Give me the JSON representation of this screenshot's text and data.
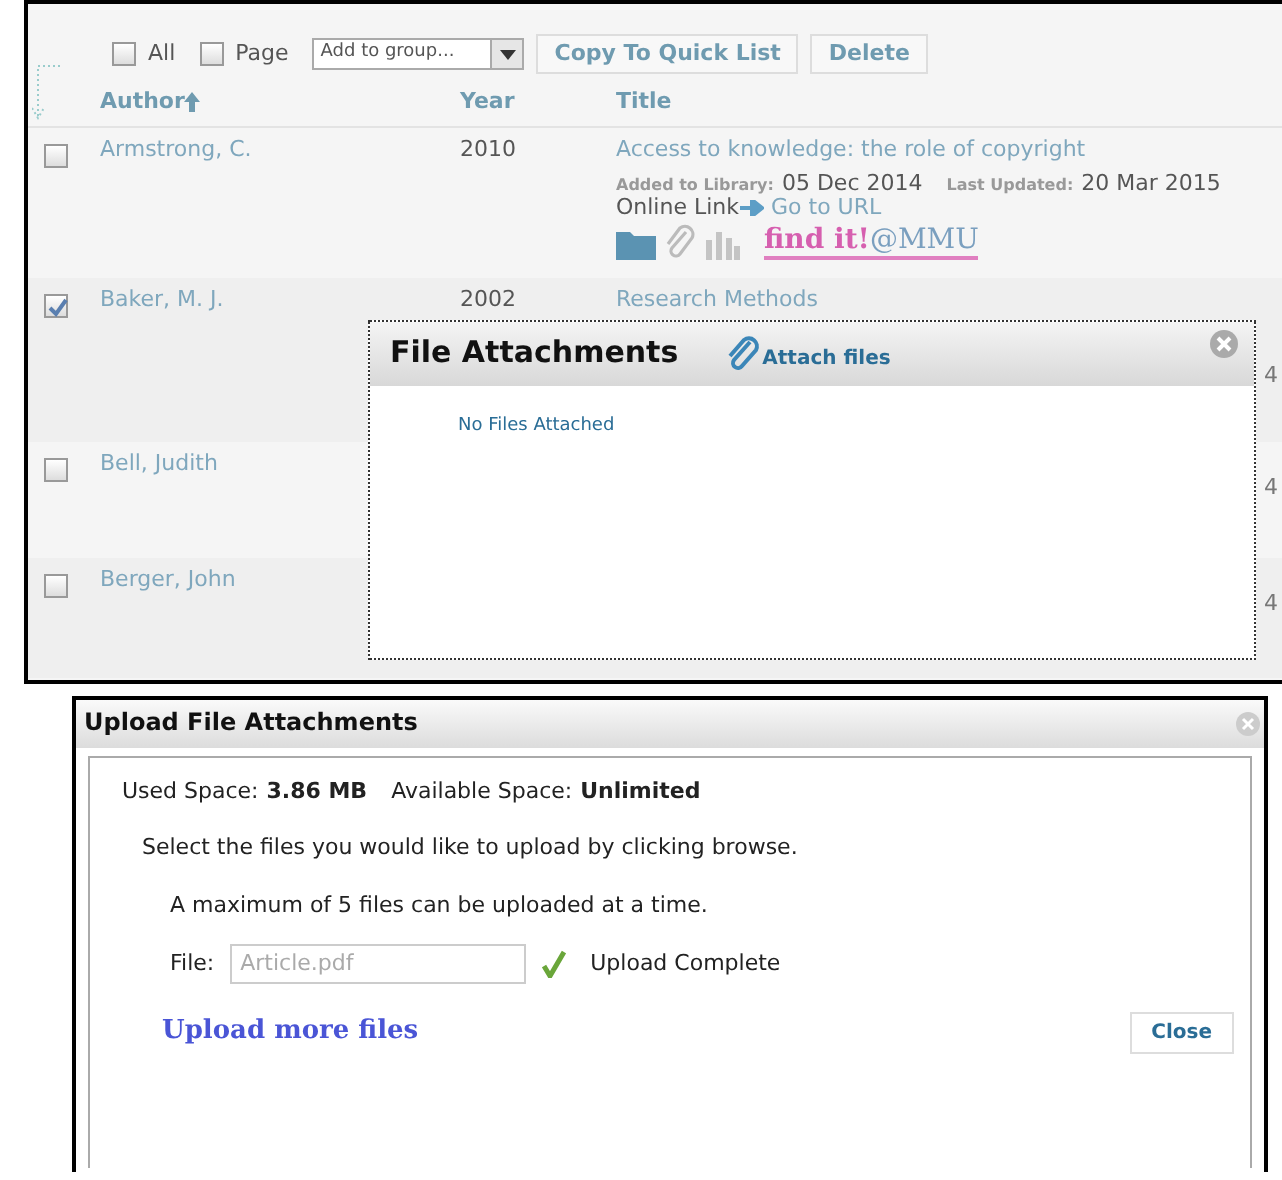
{
  "toolbar": {
    "checkboxes": [
      {
        "label": "All",
        "checked": false
      },
      {
        "label": "Page",
        "checked": false
      }
    ],
    "group_select": {
      "value": "Add to group..."
    },
    "buttons": [
      "Copy To Quick List",
      "Delete"
    ]
  },
  "columns": [
    {
      "label": "Author",
      "sorted": true
    },
    {
      "label": "Year",
      "sorted": false
    },
    {
      "label": "Title",
      "sorted": false
    }
  ],
  "rows": [
    {
      "checked": false,
      "author": "Armstrong, C.",
      "year": "2010",
      "title": "Access to knowledge: the role of copyright",
      "added_label": "Added to Library:",
      "added": "05 Dec 2014",
      "updated_label": "Last Updated:",
      "updated": "20 Mar 2015",
      "link_label": "Online Link",
      "link": "Go to URL",
      "findit": "find it!",
      "findit_suffix": "@MMU"
    },
    {
      "checked": true,
      "author": "Baker, M. J.",
      "year": "2002",
      "title": "Research Methods",
      "column_4": "4"
    },
    {
      "checked": false,
      "author": "Bell, Judith",
      "column_4": "4"
    },
    {
      "checked": false,
      "author": "Berger, John",
      "column_4": "4"
    }
  ],
  "attachments_popup": {
    "title": "File Attachments",
    "action": "Attach files",
    "message": "No Files Attached"
  },
  "upload_dialog": {
    "title": "Upload File Attachments",
    "used_label": "Used Space:",
    "used": "3.86 MB",
    "available_label": "Available Space:",
    "available": "Unlimited",
    "instructions": "Select the files you would like to upload by clicking browse.",
    "limit": "A maximum of 5 files can be uploaded at a time.",
    "file_label": "File:",
    "file_value": "Article.pdf",
    "status": "Upload Complete",
    "more_link": "Upload more files",
    "close_button": "Close"
  }
}
